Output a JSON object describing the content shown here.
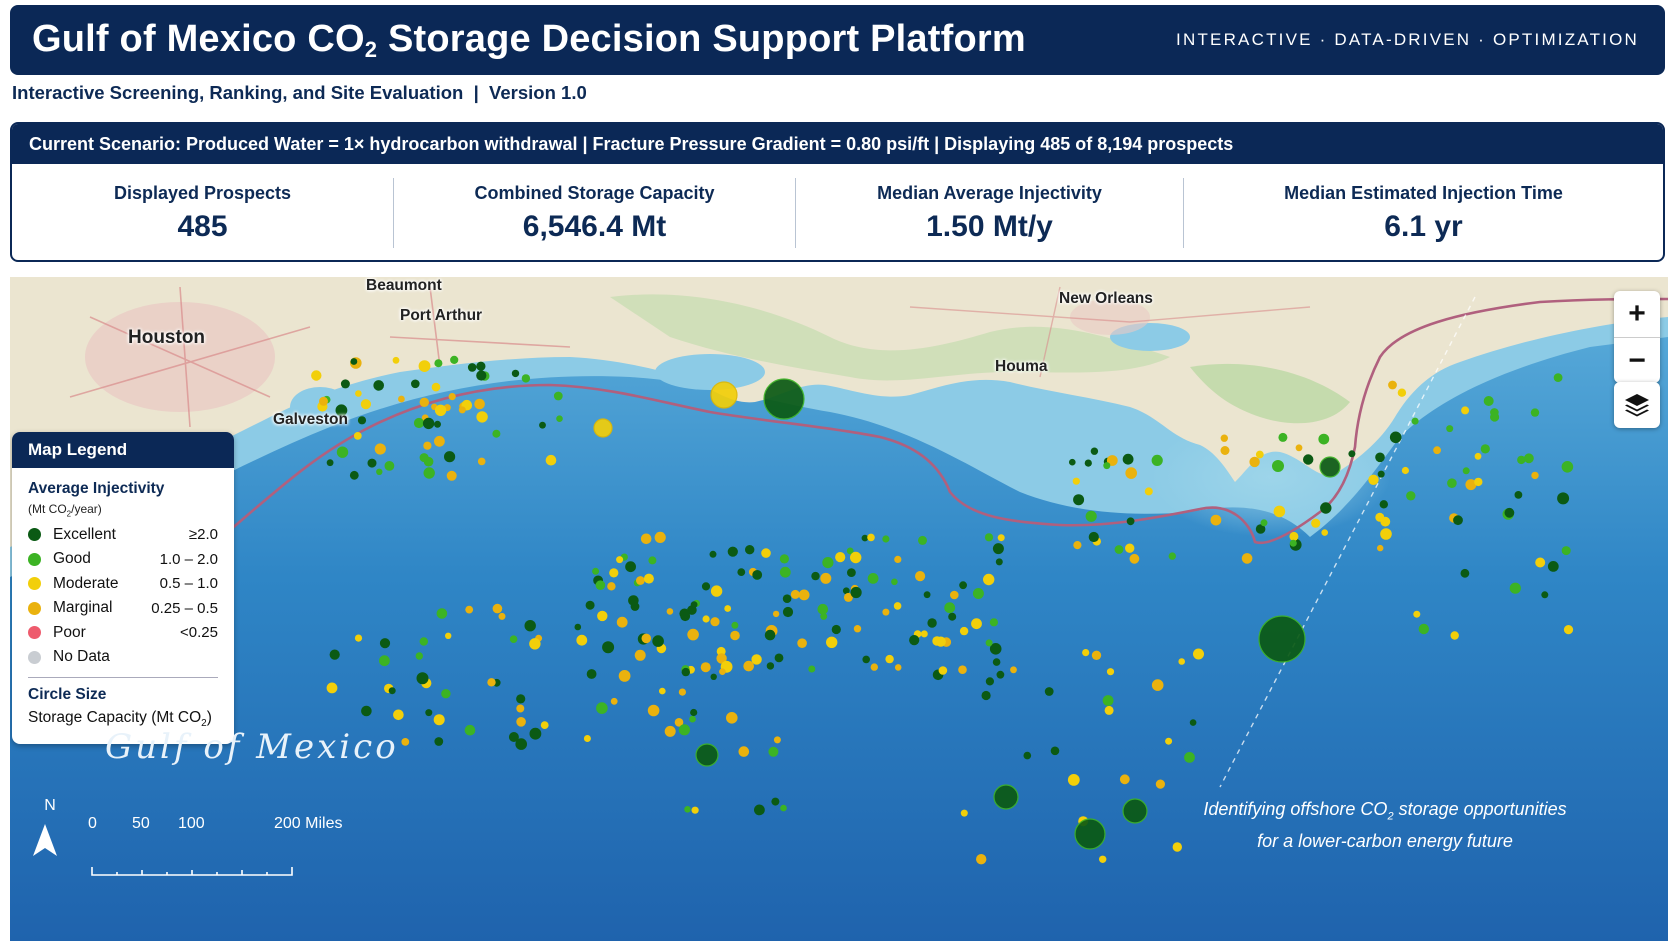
{
  "header": {
    "title_pre": "Gulf of Mexico CO",
    "title_sub": "2",
    "title_post": " Storage Decision Support Platform",
    "tags": "INTERACTIVE · DATA-DRIVEN · OPTIMIZATION"
  },
  "subtitle": "Interactive Screening, Ranking, and Site Evaluation  |  Version 1.0",
  "scenario": "Current Scenario: Produced Water = 1× hydrocarbon withdrawal  |  Fracture Pressure Gradient = 0.80 psi/ft  |  Displaying 485 of 8,194 prospects",
  "kpis": [
    {
      "label": "Displayed Prospects",
      "value": "485"
    },
    {
      "label": "Combined Storage Capacity",
      "value": "6,546.4 Mt"
    },
    {
      "label": "Median Average Injectivity",
      "value": "1.50 Mt/y"
    },
    {
      "label": "Median Estimated Injection Time",
      "value": "6.1 yr"
    }
  ],
  "map": {
    "cities": [
      "Houston",
      "Beaumont",
      "Port Arthur",
      "Galveston",
      "New Orleans",
      "Houma"
    ],
    "water_label": "Gulf of Mexico",
    "zoom_in": "+",
    "zoom_out": "−",
    "layers_icon": "layers-icon",
    "north_label": "N",
    "scale_labels": [
      "0",
      "50",
      "100",
      "200 Miles"
    ],
    "tagline_line1_pre": "Identifying offshore CO",
    "tagline_line1_sub": "2",
    "tagline_line1_post": " storage opportunities",
    "tagline_line2": "for a lower-carbon energy future"
  },
  "legend": {
    "title": "Map Legend",
    "subtitle": "Average Injectivity",
    "unit_pre": "(Mt CO",
    "unit_sub": "2",
    "unit_post": "/year)",
    "items": [
      {
        "name": "Excellent",
        "range": "≥2.0",
        "color": "#0b5a14"
      },
      {
        "name": "Good",
        "range": "1.0 – 2.0",
        "color": "#3cb324"
      },
      {
        "name": "Moderate",
        "range": "0.5 – 1.0",
        "color": "#f2cf0a"
      },
      {
        "name": "Marginal",
        "range": "0.25 – 0.5",
        "color": "#eab20e"
      },
      {
        "name": "Poor",
        "range": "<0.25",
        "color": "#ee5b6d"
      },
      {
        "name": "No Data",
        "range": "",
        "color": "#c9cdd2"
      }
    ],
    "size_title": "Circle Size",
    "size_text_pre": "Storage Capacity (Mt CO",
    "size_text_sub": "2",
    "size_text_post": ")"
  },
  "colors": {
    "banner": "#0b2856",
    "land": "#ece6d2",
    "shallow_water": "#7fc3e0",
    "deep_water": "#2f84c3",
    "boundary": "#b0607e"
  }
}
